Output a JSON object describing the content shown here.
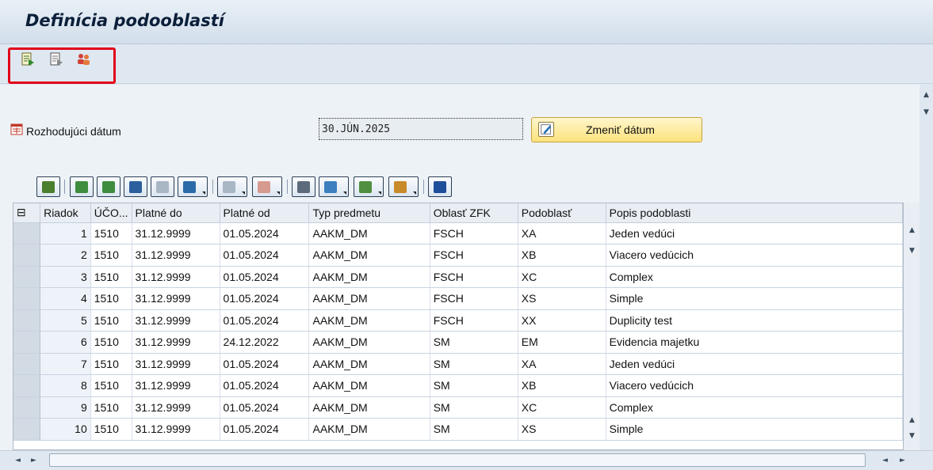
{
  "title": "Definícia podooblastí",
  "toolbar": {
    "icons": [
      "execute-icon",
      "display-icon",
      "users-icon"
    ]
  },
  "date_label": "Rozhodujúci dátum",
  "date_value": "30.JÚN.2025",
  "change_date_button": "Zmeniť dátum",
  "grid": {
    "headers": [
      "Riadok",
      "ÚČO...",
      "Platné do",
      "Platné od",
      "Typ predmetu",
      "Oblasť ZFK",
      "Podoblasť",
      "Popis podoblasti"
    ],
    "rows": [
      [
        "1",
        "1510",
        "31.12.9999",
        "01.05.2024",
        "AAKM_DM",
        "FSCH",
        "XA",
        "Jeden vedúci"
      ],
      [
        "2",
        "1510",
        "31.12.9999",
        "01.05.2024",
        "AAKM_DM",
        "FSCH",
        "XB",
        "Viacero vedúcich"
      ],
      [
        "3",
        "1510",
        "31.12.9999",
        "01.05.2024",
        "AAKM_DM",
        "FSCH",
        "XC",
        "Complex"
      ],
      [
        "4",
        "1510",
        "31.12.9999",
        "01.05.2024",
        "AAKM_DM",
        "FSCH",
        "XS",
        "Simple"
      ],
      [
        "5",
        "1510",
        "31.12.9999",
        "01.05.2024",
        "AAKM_DM",
        "FSCH",
        "XX",
        "Duplicity test"
      ],
      [
        "6",
        "1510",
        "31.12.9999",
        "24.12.2022",
        "AAKM_DM",
        "SM",
        "EM",
        "Evidencia majetku"
      ],
      [
        "7",
        "1510",
        "31.12.9999",
        "01.05.2024",
        "AAKM_DM",
        "SM",
        "XA",
        "Jeden vedúci"
      ],
      [
        "8",
        "1510",
        "31.12.9999",
        "01.05.2024",
        "AAKM_DM",
        "SM",
        "XB",
        "Viacero vedúcich"
      ],
      [
        "9",
        "1510",
        "31.12.9999",
        "01.05.2024",
        "AAKM_DM",
        "SM",
        "XC",
        "Complex"
      ],
      [
        "10",
        "1510",
        "31.12.9999",
        "01.05.2024",
        "AAKM_DM",
        "SM",
        "XS",
        "Simple"
      ]
    ]
  }
}
